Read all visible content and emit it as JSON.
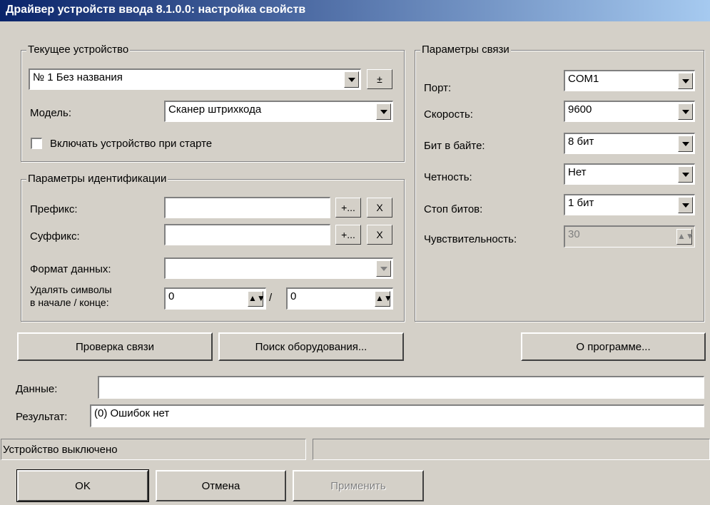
{
  "window": {
    "title": "Драйвер устройств ввода 8.1.0.0: настройка свойств"
  },
  "current_device": {
    "legend": "Текущее устройство",
    "device_value": "№ 1 Без названия",
    "plusminus_label": "±",
    "model_label": "Модель:",
    "model_value": "Сканер штрихкода",
    "enable_on_start_label": "Включать устройство при старте"
  },
  "identification": {
    "legend": "Параметры идентификации",
    "prefix_label": "Префикс:",
    "prefix_value": "",
    "suffix_label": "Суффикс:",
    "suffix_value": "",
    "add_label": "+...",
    "clear_label": "X",
    "data_format_label": "Формат данных:",
    "data_format_value": "",
    "delete_chars_label_line1": "Удалять символы",
    "delete_chars_label_line2": "в начале / конце:",
    "delete_start_value": "0",
    "slash": "/",
    "delete_end_value": "0"
  },
  "connection": {
    "legend": "Параметры связи",
    "port_label": "Порт:",
    "port_value": "COM1",
    "speed_label": "Скорость:",
    "speed_value": "9600",
    "bits_label": "Бит в байте:",
    "bits_value": "8 бит",
    "parity_label": "Четность:",
    "parity_value": "Нет",
    "stop_label": "Стоп битов:",
    "stop_value": "1 бит",
    "sensitivity_label": "Чувствительность:",
    "sensitivity_value": "30"
  },
  "actions": {
    "check_connection": "Проверка связи",
    "search_equipment": "Поиск оборудования...",
    "about": "О программе..."
  },
  "output": {
    "data_label": "Данные:",
    "data_value": "",
    "result_label": "Результат:",
    "result_value": "(0) Ошибок нет"
  },
  "status": {
    "text": "Устройство выключено",
    "secondary": ""
  },
  "footer": {
    "ok": "OK",
    "cancel": "Отмена",
    "apply": "Применить"
  },
  "colors": {
    "title_start": "#0a246a",
    "title_end": "#a6caf0",
    "face": "#d4d0c8"
  }
}
